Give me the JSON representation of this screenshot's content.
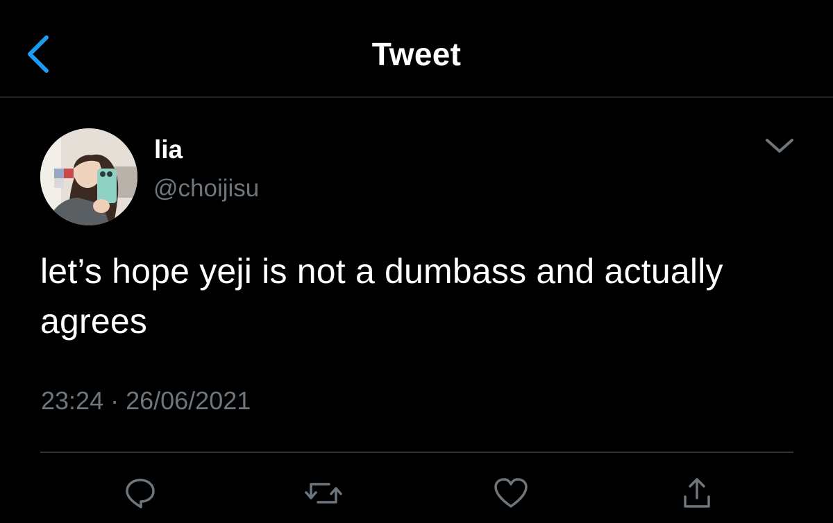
{
  "header": {
    "title": "Tweet"
  },
  "tweet": {
    "author": {
      "display_name": "lia",
      "handle": "@choijisu"
    },
    "text": "let’s hope yeji is not a dumbass and actually agrees",
    "time": "23:24",
    "separator": "·",
    "date": "26/06/2021"
  },
  "actions": {
    "reply_icon": "comment-bubble-icon",
    "retweet_icon": "retweet-icon",
    "like_icon": "heart-icon",
    "share_icon": "share-upload-icon"
  },
  "colors": {
    "background": "#000000",
    "accent": "#1d9bf0",
    "secondary_text": "#6e767d",
    "divider": "#2f3336"
  }
}
